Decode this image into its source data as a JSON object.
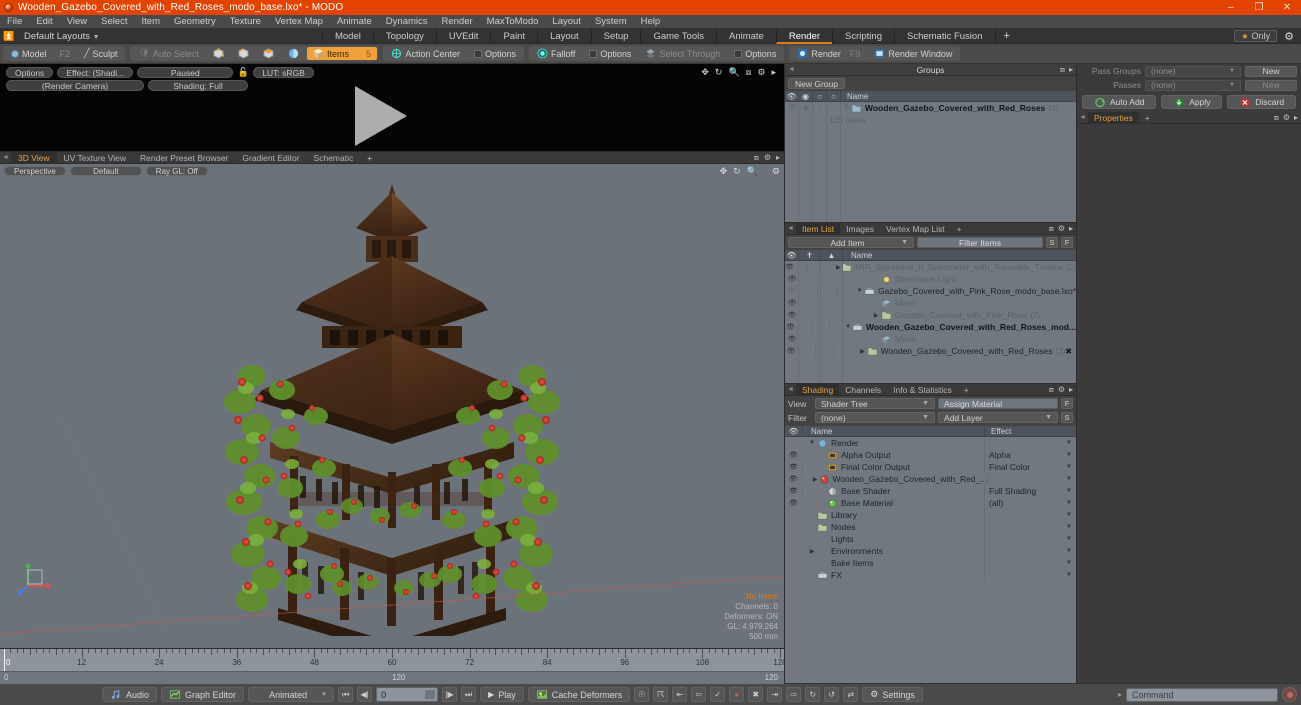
{
  "window": {
    "title": "Wooden_Gazebo_Covered_with_Red_Roses_modo_base.lxo* - MODO",
    "minimize": "–",
    "maximize": "❐",
    "close": "✕"
  },
  "menubar": [
    "File",
    "Edit",
    "View",
    "Select",
    "Item",
    "Geometry",
    "Texture",
    "Vertex Map",
    "Animate",
    "Dynamics",
    "Render",
    "MaxToModo",
    "Layout",
    "System",
    "Help"
  ],
  "layout_row": {
    "dropdown_label": "Default Layouts",
    "tabs": [
      "Model",
      "Topology",
      "UVEdit",
      "Paint",
      "Layout",
      "Setup",
      "Game Tools",
      "Animate",
      "Render",
      "Scripting",
      "Schematic Fusion"
    ],
    "active_tab": "Render",
    "plus": "+",
    "only_label": "Only",
    "gear": "⚙"
  },
  "modebar": {
    "mode_model": "Model",
    "mode_model_key": "F2",
    "mode_sculpt": "Sculpt",
    "auto_select": "Auto Select",
    "items": "Items",
    "items_key": "5",
    "action_center": "Action Center",
    "options1": "Options",
    "falloff": "Falloff",
    "options2": "Options",
    "select_through": "Select Through",
    "options3": "Options",
    "render": "Render",
    "render_key": "F9",
    "render_window": "Render Window"
  },
  "render_preview": {
    "options": "Options",
    "effect": "Effect: (Shadi...",
    "paused": "Paused",
    "lut": "LUT: sRGB",
    "camera": "(Render Camera)",
    "shading": "Shading: Full",
    "lock_icon": "lock-open-icon"
  },
  "viewport_tabs": {
    "tabs": [
      "3D View",
      "UV Texture View",
      "Render Preset Browser",
      "Gradient Editor",
      "Schematic"
    ],
    "active": "3D View",
    "plus": "+"
  },
  "viewport": {
    "pills": [
      "Perspective",
      "Default",
      "Ray GL: Off"
    ],
    "info": {
      "selection": "No Items",
      "channels": "Channels: 0",
      "deformers": "Deformers: ON",
      "gl": "GL: 4,979,264",
      "scale": "500 mm"
    },
    "bg_color": "#6c7279",
    "wood_color": "#5a3a22",
    "rose_color": "#c0392b",
    "leaf_color": "#6f9c33"
  },
  "timeline": {
    "labels": [
      "0",
      "12",
      "24",
      "36",
      "48",
      "60",
      "72",
      "84",
      "96",
      "108",
      "120"
    ],
    "start": 0,
    "end": 120,
    "playhead": 0,
    "range_start": "0",
    "range_mid": "120",
    "range_end": "120"
  },
  "bottombar": {
    "audio": "Audio",
    "graph_editor": "Graph Editor",
    "anim_mode": "Animated",
    "frame_value": "0",
    "play": "Play",
    "cache_deformers": "Cache Deformers",
    "settings": "Settings",
    "command_placeholder": "Command"
  },
  "groups_panel": {
    "title": "Groups",
    "new_group": "New Group",
    "columns": [
      "Name"
    ],
    "rows": [
      {
        "name": "Wooden_Gazebo_Covered_with_Red_Roses",
        "count": "(3)",
        "sub": "139 Items",
        "bold": true
      }
    ]
  },
  "item_list_panel": {
    "tabs": [
      "Item List",
      "Images",
      "Vertex Map List"
    ],
    "active_tab": "Item List",
    "plus": "+",
    "add_item": "Add Item",
    "filter_items": "Filter Items",
    "btn_s": "S",
    "btn_f": "F",
    "column_name": "Name",
    "rows": [
      {
        "name": "MIR_Spirobank_II_Spirometer_with_Reusable_Turbine",
        "count": "(2)",
        "indent": 2,
        "twisty": "▶",
        "icon": "folder-icon",
        "muted": true,
        "eye": true
      },
      {
        "name": "Directional Light",
        "count": "",
        "indent": 2,
        "twisty": "",
        "icon": "light-icon",
        "muted": true,
        "eye": true
      },
      {
        "name": "Gazebo_Covered_with_Pink_Rose_modo_base.lxo*",
        "count": "",
        "indent": 1,
        "twisty": "▼",
        "icon": "scene-icon",
        "muted": false,
        "eye": false
      },
      {
        "name": "Mesh",
        "count": "",
        "indent": 2,
        "twisty": "",
        "icon": "mesh-icon",
        "muted": true,
        "eye": true
      },
      {
        "name": "Gazebo_Covered_with_Pink_Rose",
        "count": "(2)",
        "indent": 2,
        "twisty": "▶",
        "icon": "folder-icon",
        "muted": true,
        "eye": true
      },
      {
        "name": "Wooden_Gazebo_Covered_with_Red_Roses_mod...",
        "count": "",
        "indent": 1,
        "twisty": "▼",
        "icon": "scene-icon",
        "muted": false,
        "bold": true,
        "eye": true
      },
      {
        "name": "Mesh",
        "count": "",
        "indent": 2,
        "twisty": "",
        "icon": "mesh-icon",
        "muted": true,
        "eye": true
      },
      {
        "name": "Wooden_Gazebo_Covered_with_Red_Roses",
        "count": "(2)",
        "indent": 2,
        "twisty": "▶",
        "icon": "folder-icon",
        "muted": false,
        "eye": true,
        "badge": "✖"
      }
    ]
  },
  "shading_panel": {
    "tabs": [
      "Shading",
      "Channels",
      "Info & Statistics"
    ],
    "active_tab": "Shading",
    "plus": "+",
    "view_label": "View",
    "view_value": "Shader Tree",
    "assign_material": "Assign Material",
    "btn_f": "F",
    "filter_label": "Filter",
    "filter_value": "(none)",
    "add_layer": "Add Layer",
    "btn_s": "S",
    "col_name": "Name",
    "col_effect": "Effect",
    "rows": [
      {
        "name": "Render",
        "effect": "",
        "indent": 0,
        "twisty": "▼",
        "icon": "render-icon",
        "eye": false
      },
      {
        "name": "Alpha Output",
        "effect": "Alpha",
        "indent": 1,
        "twisty": "",
        "icon": "output-icon",
        "eye": true
      },
      {
        "name": "Final Color Output",
        "effect": "Final Color",
        "indent": 1,
        "twisty": "",
        "icon": "output-icon",
        "eye": true
      },
      {
        "name": "Wooden_Gazebo_Covered_with_Red_...",
        "effect": "",
        "indent": 1,
        "twisty": "▶",
        "icon": "material-icon",
        "eye": true
      },
      {
        "name": "Base Shader",
        "effect": "Full Shading",
        "indent": 1,
        "twisty": "",
        "icon": "shader-icon",
        "eye": true
      },
      {
        "name": "Base Material",
        "effect": "(all)",
        "indent": 1,
        "twisty": "",
        "icon": "basemat-icon",
        "eye": true
      },
      {
        "name": "Library",
        "effect": "",
        "indent": 0,
        "twisty": "",
        "icon": "folder-icon",
        "eye": false
      },
      {
        "name": "Nodes",
        "effect": "",
        "indent": 0,
        "twisty": "",
        "icon": "folder-icon",
        "eye": false
      },
      {
        "name": "Lights",
        "effect": "",
        "indent": 0,
        "twisty": "",
        "icon": "",
        "eye": false
      },
      {
        "name": "Environments",
        "effect": "",
        "indent": 0,
        "twisty": "▶",
        "icon": "",
        "eye": false
      },
      {
        "name": "Bake Items",
        "effect": "",
        "indent": 0,
        "twisty": "",
        "icon": "",
        "eye": false
      },
      {
        "name": "FX",
        "effect": "",
        "indent": 0,
        "twisty": "",
        "icon": "fx-icon",
        "eye": false
      }
    ]
  },
  "right_panel": {
    "pass_groups_label": "Pass Groups",
    "pass_groups_value": "(none)",
    "pass_groups_new": "New",
    "passes_label": "Passes",
    "passes_value": "(none)",
    "passes_new": "New",
    "auto_add": "Auto Add",
    "apply": "Apply",
    "discard": "Discard",
    "properties_tab": "Properties",
    "plus": "+"
  }
}
